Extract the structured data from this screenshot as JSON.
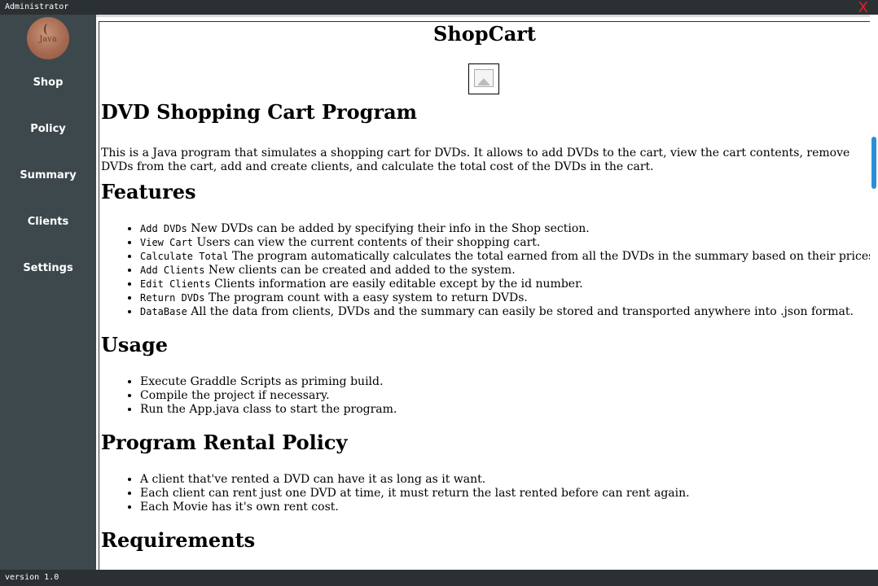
{
  "window": {
    "user": "Administrator",
    "close_label": "X"
  },
  "sidebar": {
    "items": [
      {
        "label": "Shop"
      },
      {
        "label": "Policy"
      },
      {
        "label": "Summary"
      },
      {
        "label": "Clients"
      },
      {
        "label": "Settings"
      }
    ]
  },
  "doc": {
    "title": "ShopCart",
    "heading_main": "DVD Shopping Cart Program",
    "intro": "This is a Java program that simulates a shopping cart for DVDs. It allows to add DVDs to the cart, view the cart contents, remove DVDs from the cart, add and create clients, and calculate the total cost of the DVDs in the cart.",
    "features_heading": "Features",
    "features": [
      {
        "code": "Add DVDs",
        "text": " New DVDs can be added by specifying their info in the Shop section."
      },
      {
        "code": "View Cart",
        "text": " Users can view the current contents of their shopping cart."
      },
      {
        "code": "Calculate Total",
        "text": " The program automatically calculates the total earned from all the DVDs in the summary based on their prices."
      },
      {
        "code": "Add Clients",
        "text": " New clients can be created and added to the system."
      },
      {
        "code": "Edit Clients",
        "text": " Clients information are easily editable except by the id number."
      },
      {
        "code": "Return DVDs",
        "text": " The program count with a easy system to return DVDs."
      },
      {
        "code": "DataBase",
        "text": " All the data from clients, DVDs and the summary can easily be stored and transported anywhere into .json format."
      }
    ],
    "usage_heading": "Usage",
    "usage": [
      "Execute Graddle Scripts as priming build.",
      "Compile the project if necessary.",
      "Run the App.java class to start the program."
    ],
    "policy_heading": "Program Rental Policy",
    "policy": [
      "A client that've rented a DVD can have it as long as it want.",
      "Each client can rent just one DVD at time, it must return the last rented before can rent again.",
      "Each Movie has it's own rent cost."
    ],
    "requirements_heading": "Requirements"
  },
  "status": {
    "version": "version 1.0"
  },
  "colors": {
    "accent": "#2a8fd8",
    "sidebar": "#3c484c",
    "frame": "#2b3133",
    "close": "#e8201b"
  }
}
